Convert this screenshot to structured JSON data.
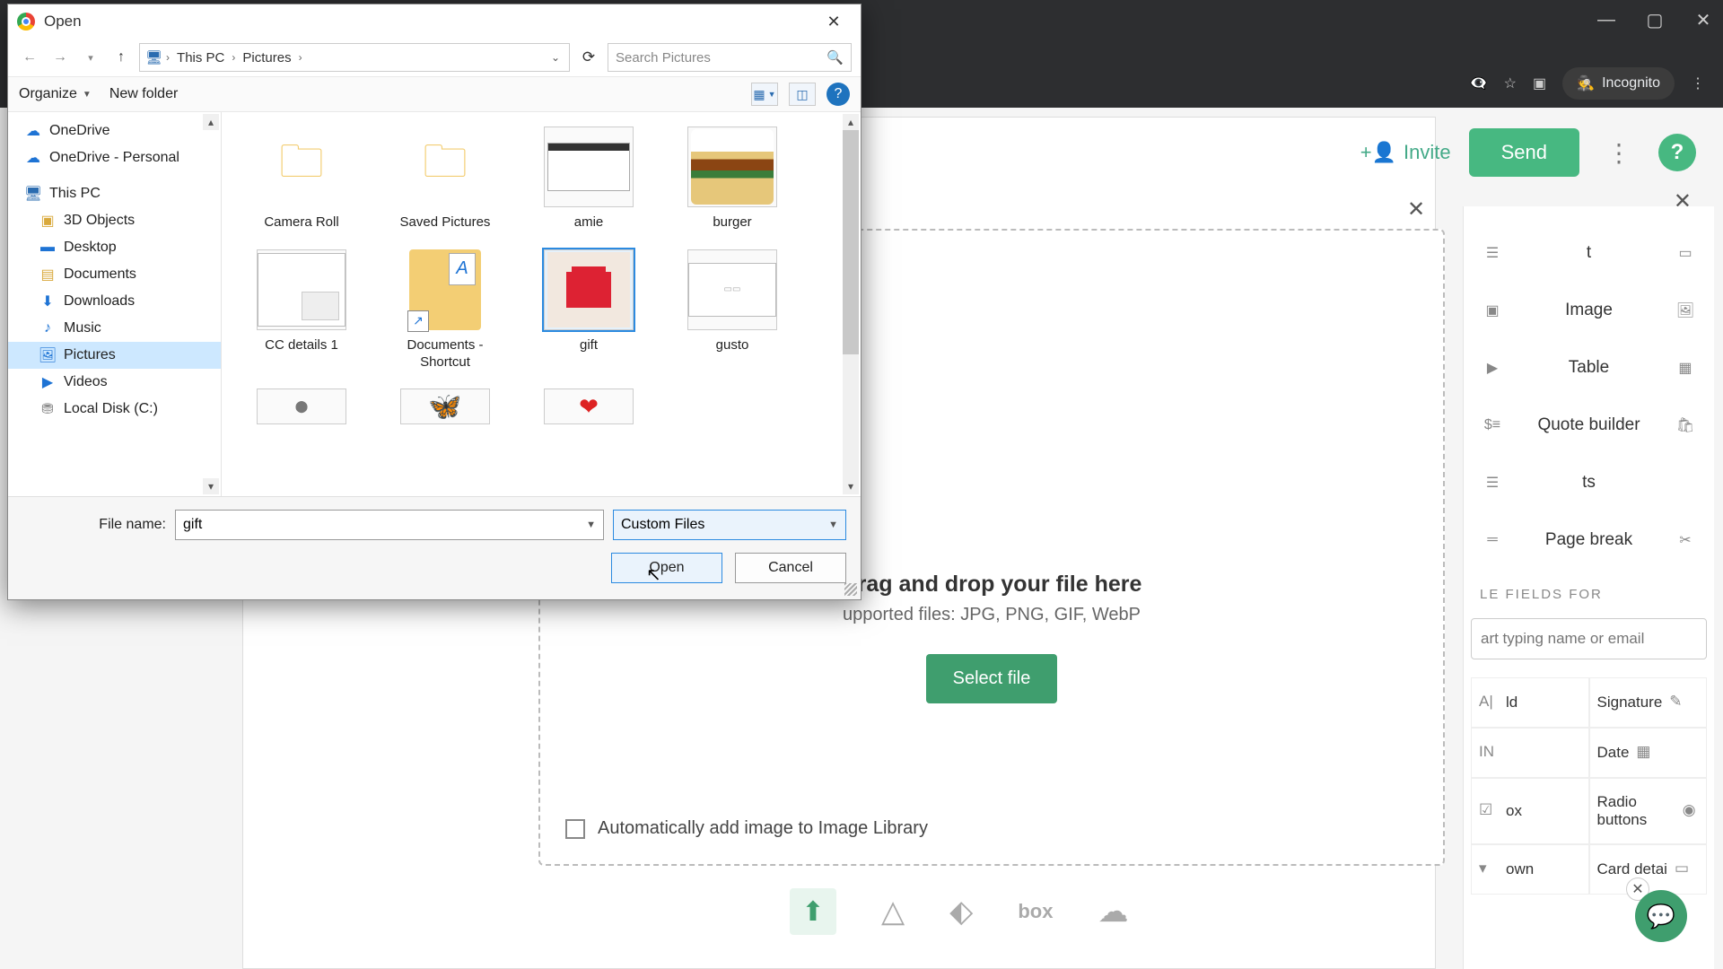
{
  "browser": {
    "incognito_label": "Incognito",
    "controls": {
      "minimize": "—",
      "maximize": "▢",
      "close": "✕"
    }
  },
  "app": {
    "invite_label": "Invite",
    "send_label": "Send",
    "help_symbol": "?",
    "panel_close": "✕",
    "dropzone": {
      "title": "Drag and drop your file here",
      "subtitle": "upported files: JPG, PNG, GIF, WebP",
      "button": "Select file",
      "checkbox_label": "Automatically add image to Image Library",
      "close": "✕"
    },
    "upload_sources": [
      "upload",
      "gdrive",
      "dropbox",
      "box",
      "cloud"
    ]
  },
  "right_panel": {
    "items": [
      {
        "label": "t",
        "icon_right": "▭"
      },
      {
        "label": "Image",
        "icon_right": "▭"
      },
      {
        "label": "Table",
        "icon_right": "▦"
      },
      {
        "label": "Quote builder",
        "icon_right": "▣"
      },
      {
        "label": "ts"
      },
      {
        "label": "Page break",
        "icon_right": "✂"
      }
    ],
    "section_title": "LE FIELDS FOR",
    "input_placeholder": "art typing name or email",
    "fields": [
      [
        {
          "label": "ld",
          "icon": "A|"
        },
        {
          "label": "Signature",
          "icon": "✎"
        }
      ],
      [
        {
          "label": "",
          "icon": "IN"
        },
        {
          "label": "Date",
          "icon": "▦"
        }
      ],
      [
        {
          "label": "ox",
          "icon": "☑"
        },
        {
          "label": "Radio buttons",
          "icon": "◉"
        }
      ],
      [
        {
          "label": "own",
          "icon": "▾"
        },
        {
          "label": "Card detai",
          "icon": "▭"
        }
      ]
    ]
  },
  "dialog": {
    "title": "Open",
    "breadcrumb": [
      "This PC",
      "Pictures"
    ],
    "search_placeholder": "Search Pictures",
    "toolbar": {
      "organize": "Organize",
      "new_folder": "New folder"
    },
    "tree": [
      {
        "label": "OneDrive",
        "icon": "cloud",
        "root": true
      },
      {
        "label": "OneDrive - Personal",
        "icon": "cloud",
        "root": true
      },
      {
        "label": "This PC",
        "icon": "pc",
        "root": true
      },
      {
        "label": "3D Objects",
        "icon": "folder"
      },
      {
        "label": "Desktop",
        "icon": "folder"
      },
      {
        "label": "Documents",
        "icon": "folder"
      },
      {
        "label": "Downloads",
        "icon": "folder"
      },
      {
        "label": "Music",
        "icon": "music"
      },
      {
        "label": "Pictures",
        "icon": "folder",
        "selected": true
      },
      {
        "label": "Videos",
        "icon": "video"
      },
      {
        "label": "Local Disk (C:)",
        "icon": "disk"
      }
    ],
    "files": [
      {
        "label": "Camera Roll",
        "type": "folder"
      },
      {
        "label": "Saved Pictures",
        "type": "folder"
      },
      {
        "label": "amie",
        "type": "amie"
      },
      {
        "label": "burger",
        "type": "burger"
      },
      {
        "label": "CC details 1",
        "type": "cc"
      },
      {
        "label": "Documents - Shortcut",
        "type": "shortcut"
      },
      {
        "label": "gift",
        "type": "gift",
        "selected": true
      },
      {
        "label": "gusto",
        "type": "gusto"
      }
    ],
    "filename_label": "File name:",
    "filename_value": "gift",
    "filetype_value": "Custom Files",
    "open_label": "Open",
    "cancel_label": "Cancel"
  }
}
